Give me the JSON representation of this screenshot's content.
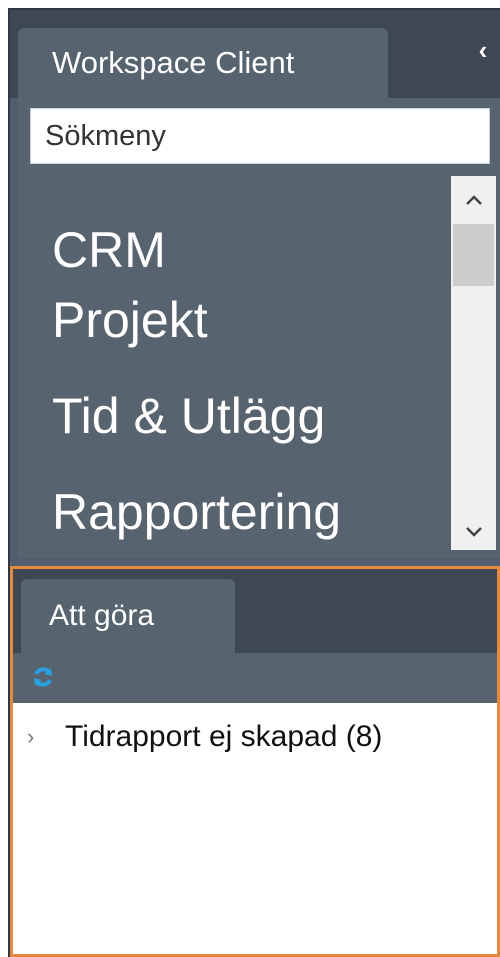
{
  "header": {
    "tab_title": "Workspace Client",
    "collapse_glyph": "‹"
  },
  "search": {
    "placeholder": "Sökmeny"
  },
  "menu": {
    "items": [
      {
        "label": "CRM"
      },
      {
        "label": "Projekt"
      },
      {
        "label": "Tid & Utlägg"
      },
      {
        "label": "Rapportering"
      }
    ],
    "scroll_up": "^",
    "scroll_down": "v"
  },
  "todo_panel": {
    "tab_title": "Att göra",
    "refresh_icon": "refresh-icon",
    "items": [
      {
        "label": "Tidrapport ej skapad (8)",
        "expander": "›"
      }
    ]
  },
  "colors": {
    "panel": "#57636f",
    "strip": "#3d4854",
    "highlight_border": "#e58a3c",
    "refresh": "#2a9fe0"
  }
}
